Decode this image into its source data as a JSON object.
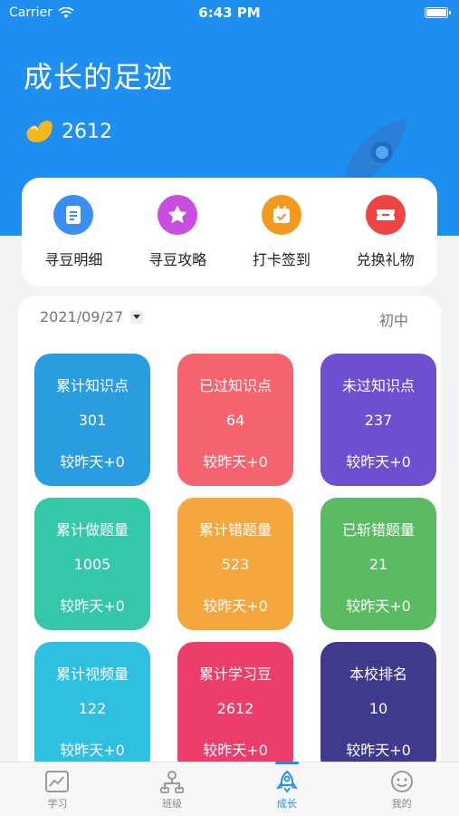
{
  "status_bar": {
    "carrier": "Carrier",
    "time": "6:43 PM"
  },
  "header": {
    "title": "成长的足迹",
    "bean_icon": "bean-icon",
    "bean_count": "2612"
  },
  "quick_actions": [
    {
      "label": "寻豆明细",
      "icon": "document-icon",
      "color": "#3b8ff0"
    },
    {
      "label": "寻豆攻略",
      "icon": "star-icon",
      "color": "#c94de0"
    },
    {
      "label": "打卡签到",
      "icon": "calendar-check-icon",
      "color": "#f39a1e"
    },
    {
      "label": "兑换礼物",
      "icon": "ticket-icon",
      "color": "#f04444"
    }
  ],
  "stats": {
    "date": "2021/09/27",
    "level": "初中",
    "tiles": [
      {
        "label": "累计知识点",
        "value": "301",
        "delta": "较昨天+0",
        "color": "#2a9de0"
      },
      {
        "label": "已过知识点",
        "value": "64",
        "delta": "较昨天+0",
        "color": "#f5646e"
      },
      {
        "label": "未过知识点",
        "value": "237",
        "delta": "较昨天+0",
        "color": "#6d4fd0"
      },
      {
        "label": "累计做题量",
        "value": "1005",
        "delta": "较昨天+0",
        "color": "#35c8a8"
      },
      {
        "label": "累计错题量",
        "value": "523",
        "delta": "较昨天+0",
        "color": "#f5a63c"
      },
      {
        "label": "已斩错题量",
        "value": "21",
        "delta": "较昨天+0",
        "color": "#5bbb62"
      },
      {
        "label": "累计视频量",
        "value": "122",
        "delta": "较昨天+0",
        "color": "#2fbfe0"
      },
      {
        "label": "累计学习豆",
        "value": "2612",
        "delta": "较昨天+0",
        "color": "#ec3d6b"
      },
      {
        "label": "本校排名",
        "value": "10",
        "delta": "较昨天+0",
        "color": "#3f3a8e"
      }
    ]
  },
  "tabbar": {
    "tabs": [
      {
        "label": "学习",
        "icon": "chart-image-icon"
      },
      {
        "label": "班级",
        "icon": "class-tree-icon"
      },
      {
        "label": "成长",
        "icon": "rocket-icon"
      },
      {
        "label": "我的",
        "icon": "smiley-icon"
      }
    ],
    "active": "成长",
    "accent": "#1e8ff0"
  }
}
